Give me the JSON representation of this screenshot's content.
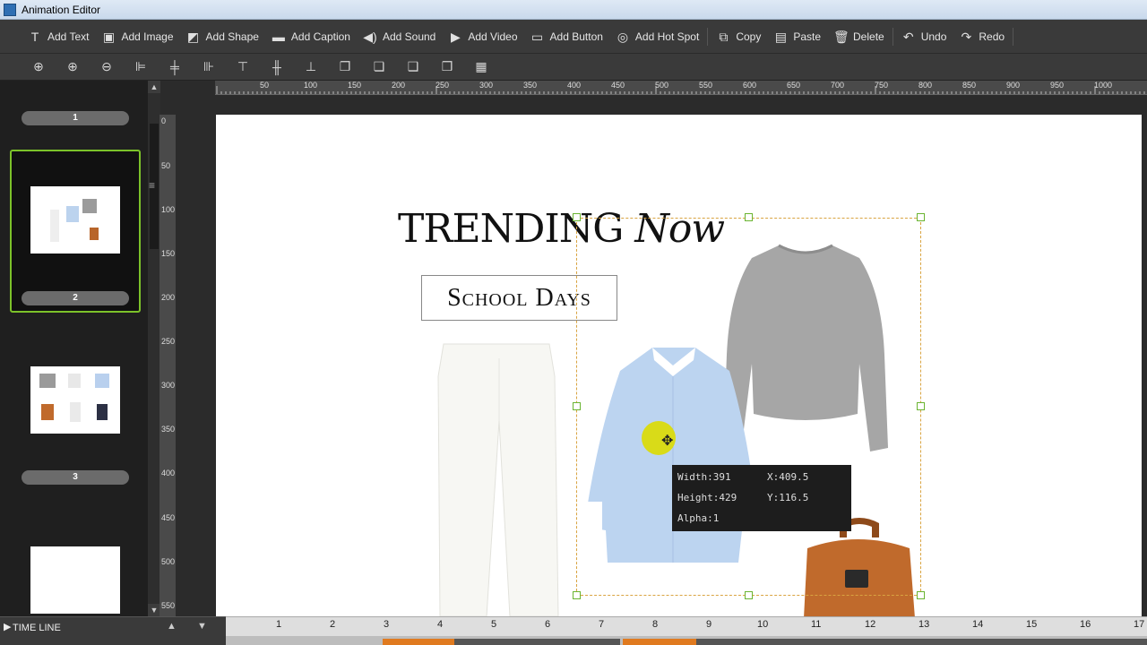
{
  "window": {
    "title": "Animation Editor"
  },
  "toolbar": {
    "buttons": [
      {
        "label": "Add Text",
        "icon": "text-icon"
      },
      {
        "label": "Add Image",
        "icon": "image-icon"
      },
      {
        "label": "Add Shape",
        "icon": "shape-icon"
      },
      {
        "label": "Add Caption",
        "icon": "caption-icon"
      },
      {
        "label": "Add Sound",
        "icon": "sound-icon"
      },
      {
        "label": "Add Video",
        "icon": "video-icon"
      },
      {
        "label": "Add Button",
        "icon": "button-icon"
      },
      {
        "label": "Add Hot Spot",
        "icon": "hotspot-icon"
      },
      {
        "label": "Copy",
        "icon": "copy-icon"
      },
      {
        "label": "Paste",
        "icon": "paste-icon"
      },
      {
        "label": "Delete",
        "icon": "delete-icon"
      },
      {
        "label": "Undo",
        "icon": "undo-icon"
      },
      {
        "label": "Redo",
        "icon": "redo-icon"
      }
    ]
  },
  "slides": [
    {
      "number": "1"
    },
    {
      "number": "2"
    },
    {
      "number": "3"
    }
  ],
  "ruler": {
    "top": [
      "50",
      "100",
      "150",
      "200",
      "250",
      "300",
      "350",
      "400",
      "450",
      "500",
      "550",
      "600",
      "650",
      "700",
      "750",
      "800",
      "850",
      "900",
      "950",
      "1000"
    ],
    "left": [
      "0",
      "50",
      "100",
      "150",
      "200",
      "250",
      "300",
      "350",
      "400",
      "450",
      "500",
      "550"
    ]
  },
  "stage": {
    "headline_main": "TRENDING",
    "headline_italic": "Now",
    "subtitle": "School Days"
  },
  "selection_info": {
    "width": "Width:391",
    "height": "Height:429",
    "alpha": "Alpha:1",
    "x": "X:409.5",
    "y": "Y:116.5"
  },
  "timeline": {
    "label": "TIME LINE",
    "numbers": [
      "1",
      "2",
      "3",
      "4",
      "5",
      "6",
      "7",
      "8",
      "9",
      "10",
      "11",
      "12",
      "13",
      "14",
      "15",
      "16",
      "17"
    ]
  },
  "colors": {
    "accent_selected_slide": "#7cc22a",
    "selection_border": "#d9a441",
    "timeline_segment": "#e07a1f"
  }
}
